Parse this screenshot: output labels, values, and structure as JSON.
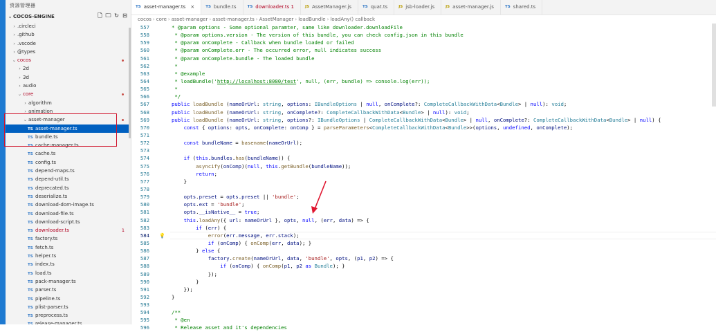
{
  "sidebar": {
    "title": "资源管理器",
    "root": "COCOS-ENGINE",
    "items": [
      {
        "label": ".circleci",
        "indent": 1,
        "type": "folder-closed"
      },
      {
        "label": ".github",
        "indent": 1,
        "type": "folder-closed"
      },
      {
        "label": ".vscode",
        "indent": 1,
        "type": "folder-closed"
      },
      {
        "label": "@types",
        "indent": 1,
        "type": "folder-closed"
      },
      {
        "label": "cocos",
        "indent": 1,
        "type": "folder-open",
        "red": true,
        "dot": true
      },
      {
        "label": "2d",
        "indent": 2,
        "type": "folder-closed"
      },
      {
        "label": "3d",
        "indent": 2,
        "type": "folder-closed"
      },
      {
        "label": "audio",
        "indent": 2,
        "type": "folder-closed"
      },
      {
        "label": "core",
        "indent": 2,
        "type": "folder-open",
        "red": true,
        "dot": true
      },
      {
        "label": "algorithm",
        "indent": 3,
        "type": "folder-closed"
      },
      {
        "label": "animation",
        "indent": 3,
        "type": "folder-closed"
      },
      {
        "label": "asset-manager",
        "indent": 3,
        "type": "folder-open",
        "dot": true
      },
      {
        "label": "asset-manager.ts",
        "indent": 4,
        "type": "ts",
        "selected": true
      },
      {
        "label": "bundle.ts",
        "indent": 4,
        "type": "ts"
      },
      {
        "label": "cache-manager.ts",
        "indent": 4,
        "type": "ts"
      },
      {
        "label": "cache.ts",
        "indent": 4,
        "type": "ts"
      },
      {
        "label": "config.ts",
        "indent": 4,
        "type": "ts"
      },
      {
        "label": "depend-maps.ts",
        "indent": 4,
        "type": "ts"
      },
      {
        "label": "depend-util.ts",
        "indent": 4,
        "type": "ts"
      },
      {
        "label": "deprecated.ts",
        "indent": 4,
        "type": "ts"
      },
      {
        "label": "deserialize.ts",
        "indent": 4,
        "type": "ts"
      },
      {
        "label": "download-dom-image.ts",
        "indent": 4,
        "type": "ts"
      },
      {
        "label": "download-file.ts",
        "indent": 4,
        "type": "ts"
      },
      {
        "label": "download-script.ts",
        "indent": 4,
        "type": "ts"
      },
      {
        "label": "downloader.ts",
        "indent": 4,
        "type": "ts",
        "red": true,
        "badge": "1"
      },
      {
        "label": "factory.ts",
        "indent": 4,
        "type": "ts"
      },
      {
        "label": "fetch.ts",
        "indent": 4,
        "type": "ts"
      },
      {
        "label": "helper.ts",
        "indent": 4,
        "type": "ts"
      },
      {
        "label": "index.ts",
        "indent": 4,
        "type": "ts"
      },
      {
        "label": "load.ts",
        "indent": 4,
        "type": "ts"
      },
      {
        "label": "pack-manager.ts",
        "indent": 4,
        "type": "ts"
      },
      {
        "label": "parser.ts",
        "indent": 4,
        "type": "ts"
      },
      {
        "label": "pipeline.ts",
        "indent": 4,
        "type": "ts"
      },
      {
        "label": "plist-parser.ts",
        "indent": 4,
        "type": "ts"
      },
      {
        "label": "preprocess.ts",
        "indent": 4,
        "type": "ts"
      },
      {
        "label": "release-manager.ts",
        "indent": 4,
        "type": "ts"
      }
    ]
  },
  "tabs": [
    {
      "label": "asset-manager.ts",
      "icon": "TS",
      "active": true,
      "close": "×"
    },
    {
      "label": "bundle.ts",
      "icon": "TS"
    },
    {
      "label": "downloader.ts 1",
      "icon": "TS",
      "red": true
    },
    {
      "label": "AssetManager.js",
      "icon": "JS"
    },
    {
      "label": "quat.ts",
      "icon": "TS"
    },
    {
      "label": "jsb-loader.js",
      "icon": "JS"
    },
    {
      "label": "asset-manager.js",
      "icon": "JS"
    },
    {
      "label": "shared.ts",
      "icon": "TS"
    }
  ],
  "breadcrumb": [
    "cocos",
    "core",
    "asset-manager",
    "asset-manager.ts",
    "AssetManager",
    "loadBundle",
    "loadAny() callback"
  ],
  "code": [
    {
      "n": "557",
      "h": "<span class='c'>* @param options - Some optional paramter, same like downloader.downloadFile</span>"
    },
    {
      "n": "558",
      "h": "<span class='c'> * @param options.version - The version of this bundle, you can check config.json in this bundle</span>"
    },
    {
      "n": "559",
      "h": "<span class='c'> * @param onComplete - Callback when bundle loaded or failed</span>"
    },
    {
      "n": "560",
      "h": "<span class='c'> * @param onComplete.err - The occurred error, null indicates success</span>"
    },
    {
      "n": "561",
      "h": "<span class='c'> * @param onComplete.bundle - The loaded bundle</span>"
    },
    {
      "n": "562",
      "h": "<span class='c'> *</span>"
    },
    {
      "n": "563",
      "h": "<span class='c'> * @example</span>"
    },
    {
      "n": "564",
      "h": "<span class='c'> * loadBundle('<span class=\"u\">http://localhost:8080/test</span>', null, (err, bundle) =&gt; console.log(err));</span>"
    },
    {
      "n": "565",
      "h": "<span class='c'> *</span>"
    },
    {
      "n": "566",
      "h": "<span class='c'> */</span>"
    },
    {
      "n": "567",
      "h": "<span class='k'>public</span> <span class='f'>loadBundle</span> (<span class='v'>nameOrUrl</span>: <span class='t'>string</span>, <span class='v'>options</span>: <span class='t'>IBundleOptions</span> | <span class='kc'>null</span>, <span class='v'>onComplete</span>?: <span class='t'>CompleteCallbackWithData</span>&lt;<span class='t'>Bundle</span>&gt; | <span class='kc'>null</span>): <span class='t'>void</span>;"
    },
    {
      "n": "568",
      "h": "<span class='k'>public</span> <span class='f'>loadBundle</span> (<span class='v'>nameOrUrl</span>: <span class='t'>string</span>, <span class='v'>onComplete</span>?: <span class='t'>CompleteCallbackWithData</span>&lt;<span class='t'>Bundle</span>&gt; | <span class='kc'>null</span>): <span class='t'>void</span>;"
    },
    {
      "n": "569",
      "h": "<span class='k'>public</span> <span class='f'>loadBundle</span> (<span class='v'>nameOrUrl</span>: <span class='t'>string</span>, <span class='v'>options</span>?: <span class='t'>IBundleOptions</span> | <span class='t'>CompleteCallbackWithData</span>&lt;<span class='t'>Bundle</span>&gt; | <span class='kc'>null</span>, <span class='v'>onComplete</span>?: <span class='t'>CompleteCallbackWithData</span>&lt;<span class='t'>Bundle</span>&gt; | <span class='kc'>null</span>) {"
    },
    {
      "n": "570",
      "h": "    <span class='k'>const</span> { <span class='v'>options</span>: <span class='v'>opts</span>, <span class='v'>onComplete</span>: <span class='v'>onComp</span> } = <span class='f'>parseParameters</span>&lt;<span class='t'>CompleteCallbackWithData</span>&lt;<span class='t'>Bundle</span>&gt;&gt;(<span class='v'>options</span>, <span class='kc'>undefined</span>, <span class='v'>onComplete</span>);"
    },
    {
      "n": "571",
      "h": ""
    },
    {
      "n": "572",
      "h": "    <span class='k'>const</span> <span class='v'>bundleName</span> = <span class='f'>basename</span>(<span class='v'>nameOrUrl</span>);"
    },
    {
      "n": "573",
      "h": ""
    },
    {
      "n": "574",
      "h": "    <span class='k'>if</span> (<span class='k'>this</span>.<span class='v'>bundles</span>.<span class='f'>has</span>(<span class='v'>bundleName</span>)) {"
    },
    {
      "n": "575",
      "h": "        <span class='f'>asyncify</span>(<span class='v'>onComp</span>)(<span class='kc'>null</span>, <span class='k'>this</span>.<span class='f'>getBundle</span>(<span class='v'>bundleName</span>));"
    },
    {
      "n": "576",
      "h": "        <span class='k'>return</span>;"
    },
    {
      "n": "577",
      "h": "    }"
    },
    {
      "n": "578",
      "h": ""
    },
    {
      "n": "579",
      "h": "    <span class='v'>opts</span>.<span class='v'>preset</span> = <span class='v'>opts</span>.<span class='v'>preset</span> || <span class='s'>'bundle'</span>;"
    },
    {
      "n": "580",
      "h": "    <span class='v'>opts</span>.<span class='v'>ext</span> = <span class='s'>'bundle'</span>;"
    },
    {
      "n": "581",
      "h": "    <span class='v'>opts</span>.<span class='v'>__isNative__</span> = <span class='kc'>true</span>;"
    },
    {
      "n": "582",
      "h": "    <span class='k'>this</span>.<span class='f'>loadAny</span>({ <span class='v'>url</span>: <span class='v'>nameOrUrl</span> }, <span class='v'>opts</span>, <span class='kc'>null</span>, (<span class='v'>err</span>, <span class='v'>data</span>) =&gt; {"
    },
    {
      "n": "583",
      "h": "        <span class='k'>if</span> (<span class='v'>err</span>) {"
    },
    {
      "n": "584",
      "h": "            <span class='f'>error</span>(<span class='v'>err</span>.<span class='v'>message</span>, <span class='v'>err</span>.<span class='v'>stack</span>);",
      "cur": true
    },
    {
      "n": "585",
      "h": "            <span class='k'>if</span> (<span class='v'>onComp</span>) { <span class='f'>onComp</span>(<span class='v'>err</span>, <span class='v'>data</span>); }"
    },
    {
      "n": "586",
      "h": "        } <span class='k'>else</span> {"
    },
    {
      "n": "587",
      "h": "            <span class='v'>factory</span>.<span class='f'>create</span>(<span class='v'>nameOrUrl</span>, <span class='v'>data</span>, <span class='s'>'bundle'</span>, <span class='v'>opts</span>, (<span class='v'>p1</span>, <span class='v'>p2</span>) =&gt; {"
    },
    {
      "n": "588",
      "h": "                <span class='k'>if</span> (<span class='v'>onComp</span>) { <span class='f'>onComp</span>(<span class='v'>p1</span>, <span class='v'>p2</span> <span class='k'>as</span> <span class='t'>Bundle</span>); }"
    },
    {
      "n": "589",
      "h": "            });"
    },
    {
      "n": "590",
      "h": "        }"
    },
    {
      "n": "591",
      "h": "    });"
    },
    {
      "n": "592",
      "h": "}"
    },
    {
      "n": "593",
      "h": ""
    },
    {
      "n": "594",
      "h": "<span class='c'>/**</span>"
    },
    {
      "n": "595",
      "h": "<span class='c'> * @en</span>"
    },
    {
      "n": "596",
      "h": "<span class='c'> * Release asset and it's dependencies</span>"
    }
  ]
}
